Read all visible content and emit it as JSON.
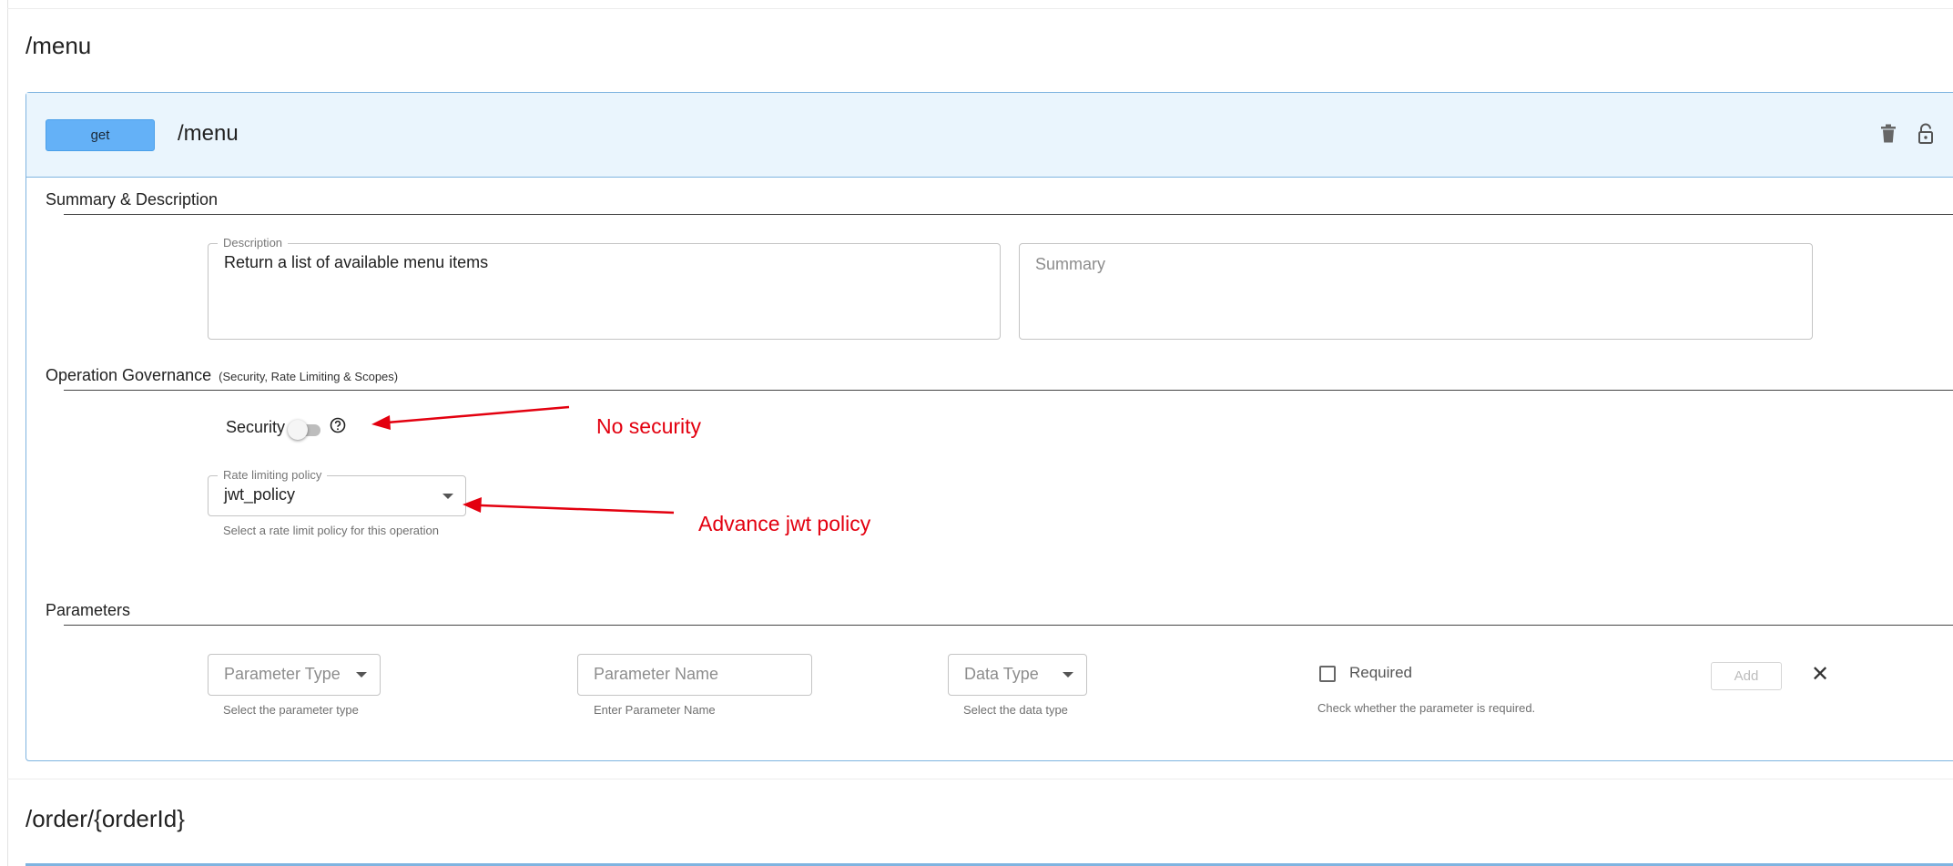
{
  "paths": [
    {
      "path": "/menu",
      "operation": {
        "method": "get",
        "path": "/menu",
        "icons": [
          "delete-icon",
          "lock-open-icon"
        ],
        "summary_section": {
          "heading": "Summary & Description",
          "description": {
            "label": "Description",
            "value": "Return a list of available menu items"
          },
          "summary": {
            "placeholder": "Summary"
          }
        },
        "governance": {
          "heading": "Operation Governance",
          "subheading": "(Security, Rate Limiting & Scopes)",
          "security_label": "Security",
          "security_enabled": false,
          "rate_limit": {
            "label": "Rate limiting policy",
            "value": "jwt_policy",
            "helper": "Select a rate limit policy for this operation"
          }
        },
        "parameters": {
          "heading": "Parameters",
          "param_type": {
            "placeholder": "Parameter Type",
            "helper": "Select the parameter type"
          },
          "param_name": {
            "placeholder": "Parameter Name",
            "helper": "Enter Parameter Name"
          },
          "data_type": {
            "placeholder": "Data Type",
            "helper": "Select the data type"
          },
          "required": {
            "label": "Required",
            "helper": "Check whether the parameter is required.",
            "checked": false
          },
          "add_label": "Add",
          "close_symbol": "✕"
        }
      }
    },
    {
      "path": "/order/{orderId}"
    }
  ],
  "annotations": {
    "security_note": "No security",
    "policy_note": "Advance jwt policy",
    "color": "#e3000f"
  }
}
